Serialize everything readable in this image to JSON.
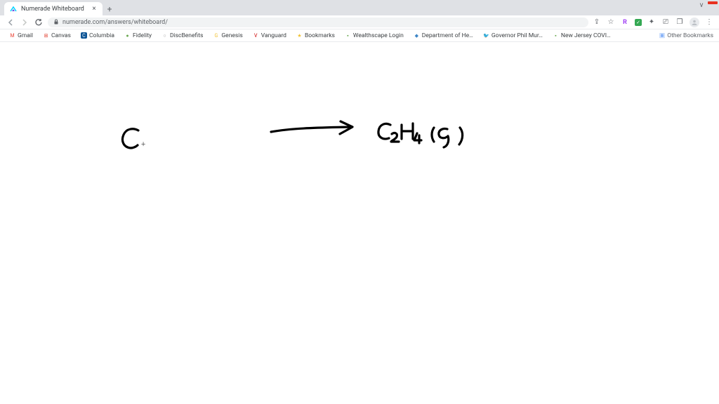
{
  "window": {
    "minimize_hint": "v"
  },
  "tab": {
    "title": "Numerade Whiteboard",
    "favicon_color_1": "#00d4ff",
    "favicon_color_2": "#6b4ce6"
  },
  "address": {
    "url": "numerade.com/answers/whiteboard/",
    "actions": {
      "share_glyph": "⇪",
      "star_glyph": "☆",
      "extension_r": "R",
      "puzzle_glyph": "✦",
      "cast_glyph": "⎚",
      "restore_glyph": "❐",
      "menu_glyph": "⋮"
    }
  },
  "bookmarks": {
    "items": [
      {
        "label": "Gmail",
        "icon_bg": "#ffffff",
        "icon_text": "M",
        "icon_color": "#ea4335"
      },
      {
        "label": "Canvas",
        "icon_bg": "#ffffff",
        "icon_text": "⊞",
        "icon_color": "#e13b2b"
      },
      {
        "label": "Columbia",
        "icon_bg": "#0b5394",
        "icon_text": "C",
        "icon_color": "#ffffff"
      },
      {
        "label": "Fidelity",
        "icon_bg": "#ffffff",
        "icon_text": "●",
        "icon_color": "#6aa84f"
      },
      {
        "label": "DiscBenefits",
        "icon_bg": "#ffffff",
        "icon_text": "○",
        "icon_color": "#999"
      },
      {
        "label": "Genesis",
        "icon_bg": "#ffffff",
        "icon_text": "G",
        "icon_color": "#f1c232"
      },
      {
        "label": "Vanguard",
        "icon_bg": "#ffffff",
        "icon_text": "V",
        "icon_color": "#cc0000"
      },
      {
        "label": "Bookmarks",
        "icon_bg": "#ffffff",
        "icon_text": "★",
        "icon_color": "#f1c232"
      },
      {
        "label": "Wealthscape Login",
        "icon_bg": "#ffffff",
        "icon_text": "▪",
        "icon_color": "#6aa84f"
      },
      {
        "label": "Department of He…",
        "icon_bg": "#ffffff",
        "icon_text": "◆",
        "icon_color": "#3d85c6"
      },
      {
        "label": "Governor Phil Mur…",
        "icon_bg": "#ffffff",
        "icon_text": "🐦",
        "icon_color": "#1da1f2"
      },
      {
        "label": "New Jersey COVI…",
        "icon_bg": "#ffffff",
        "icon_text": "▪",
        "icon_color": "#6aa84f"
      }
    ],
    "other_label": "Other Bookmarks"
  },
  "toolbar": {
    "tools": [
      "undo",
      "redo",
      "pointer",
      "pencil",
      "tools",
      "eraser",
      "text",
      "image"
    ],
    "colors": {
      "black": "#000000",
      "red": "#e6a0a0",
      "green": "#a8d5a8",
      "purple": "#b0a8e6"
    }
  },
  "handwriting": {
    "left_text": "C",
    "right_text": "C₂H₄ (g)"
  }
}
